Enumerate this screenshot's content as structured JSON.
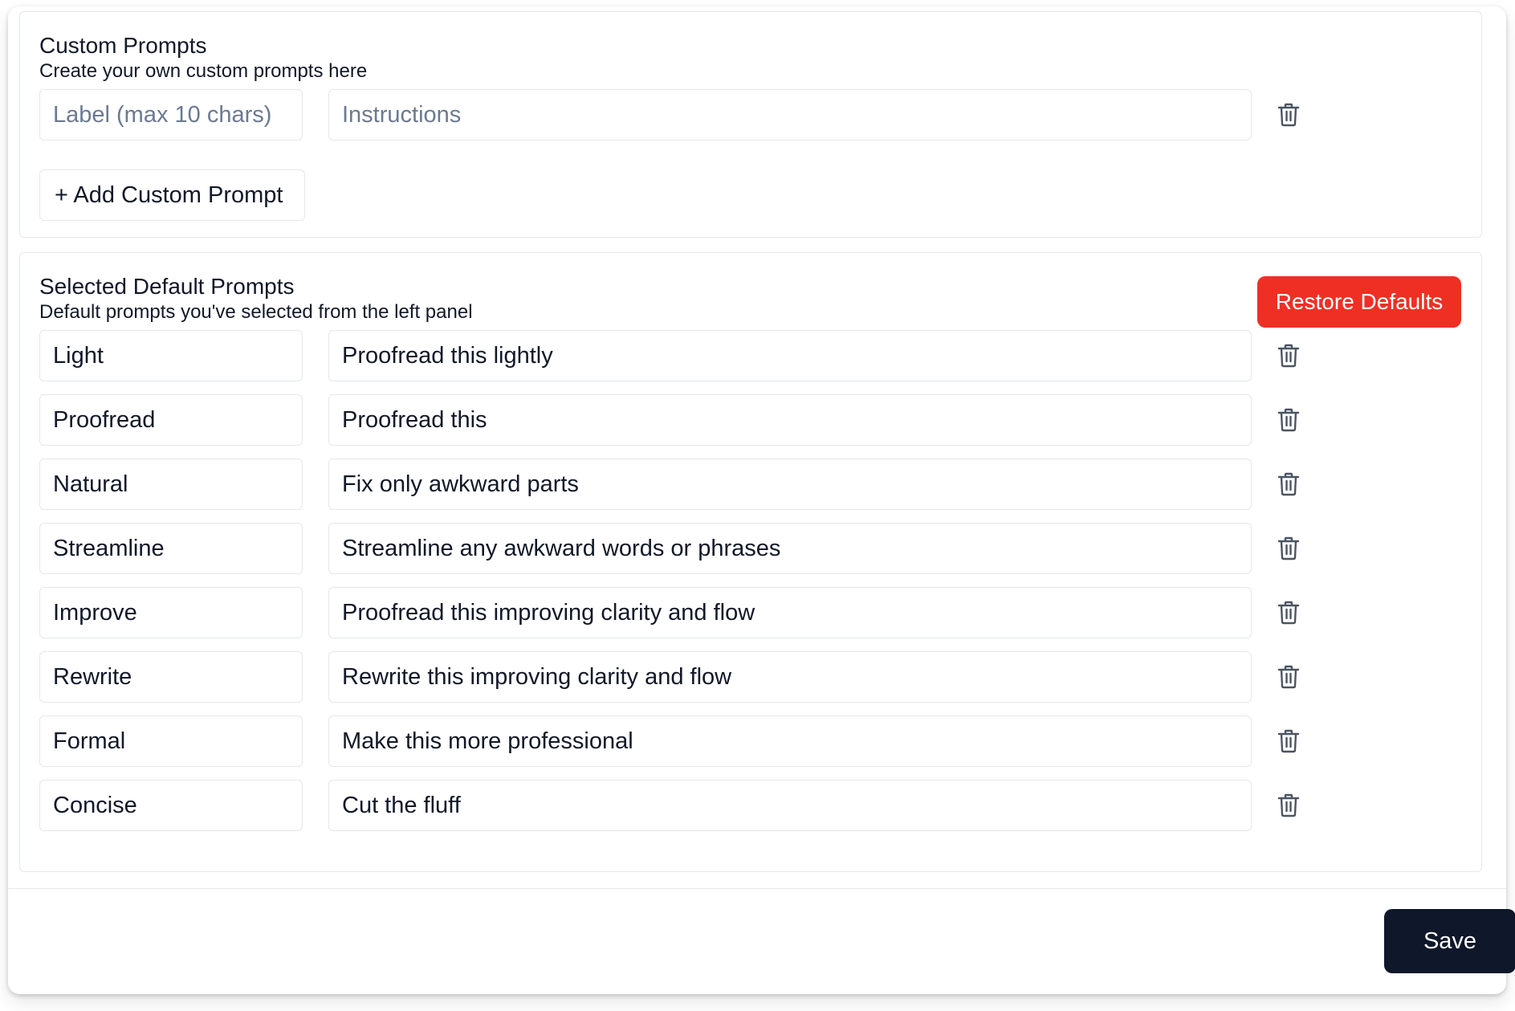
{
  "custom": {
    "title": "Custom Prompts",
    "subtitle": "Create your own custom prompts here",
    "label_placeholder": "Label (max 10 chars)",
    "instructions_placeholder": "Instructions",
    "add_button_label": "+ Add Custom Prompt"
  },
  "defaults": {
    "title": "Selected Default Prompts",
    "subtitle": "Default prompts you've selected from the left panel",
    "restore_button_label": "Restore Defaults",
    "prompts": [
      {
        "label": "Light",
        "instructions": "Proofread this lightly"
      },
      {
        "label": "Proofread",
        "instructions": "Proofread this"
      },
      {
        "label": "Natural",
        "instructions": "Fix only awkward parts"
      },
      {
        "label": "Streamline",
        "instructions": "Streamline any awkward words or phrases"
      },
      {
        "label": "Improve",
        "instructions": "Proofread this improving clarity and flow"
      },
      {
        "label": "Rewrite",
        "instructions": "Rewrite this improving clarity and flow"
      },
      {
        "label": "Formal",
        "instructions": "Make this more professional"
      },
      {
        "label": "Concise",
        "instructions": "Cut the fluff"
      }
    ]
  },
  "footer": {
    "save_label": "Save"
  },
  "icons": {
    "close": "close-icon",
    "delete": "trash-icon"
  },
  "colors": {
    "restore_button": "#ef2f24",
    "save_button": "#0f172a",
    "border": "#e5e7eb",
    "icon": "#4b5563"
  }
}
